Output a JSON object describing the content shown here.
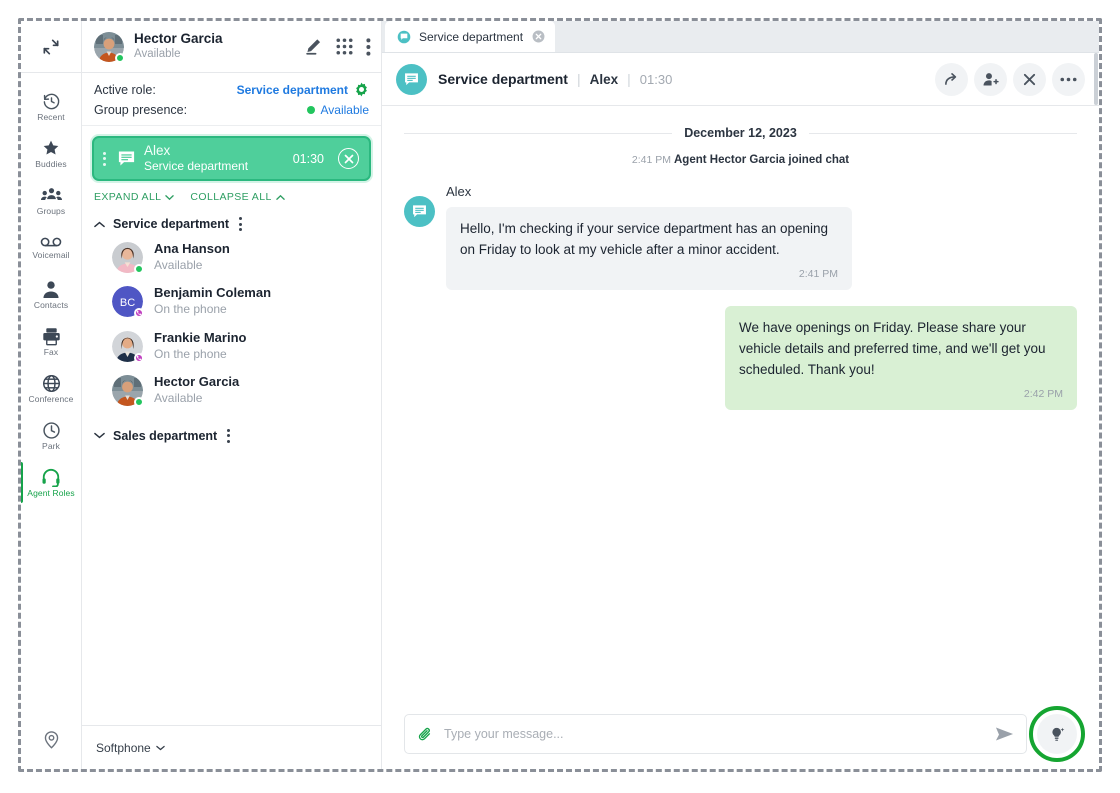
{
  "rail": {
    "collapse_icon": "collapse-arrows-icon",
    "items": [
      {
        "label": "Recent",
        "icon": "history-clock-icon",
        "active": false
      },
      {
        "label": "Buddies",
        "icon": "star-icon",
        "active": false
      },
      {
        "label": "Groups",
        "icon": "people-group-icon",
        "active": false
      },
      {
        "label": "Voicemail",
        "icon": "voicemail-icon",
        "active": false
      },
      {
        "label": "Contacts",
        "icon": "person-icon",
        "active": false
      },
      {
        "label": "Fax",
        "icon": "printer-fax-icon",
        "active": false
      },
      {
        "label": "Conference",
        "icon": "globe-icon",
        "active": false
      },
      {
        "label": "Park",
        "icon": "clock-icon",
        "active": false
      },
      {
        "label": "Agent Roles",
        "icon": "headset-icon",
        "active": true
      }
    ],
    "bottom_icon": "location-pin-icon",
    "active_color": "#16a34a"
  },
  "roster": {
    "user": {
      "name": "Hector Garcia",
      "status": "Available",
      "presence_color": "#22c55e"
    },
    "header_icons": [
      "compose-pencil-icon",
      "dialpad-grid-icon",
      "more-vertical-icon"
    ],
    "active_role_label": "Active role:",
    "active_role_value": "Service department",
    "group_presence_label": "Group presence:",
    "group_presence_value": "Available",
    "settings_icon": "gear-icon",
    "session": {
      "name": "Alex",
      "subtitle": "Service department",
      "timer": "01:30",
      "icon": "chat-bubble-icon",
      "close_icon": "close-circle-icon",
      "bg_color": "#4fcf9b"
    },
    "expand_all": "EXPAND ALL",
    "collapse_all": "COLLAPSE ALL",
    "groups": [
      {
        "title": "Service department",
        "expanded": true,
        "members": [
          {
            "name": "Ana Hanson",
            "status": "Available",
            "avatar_type": "photo",
            "presence": "available"
          },
          {
            "name": "Benjamin Coleman",
            "status": "On the phone",
            "avatar_type": "initials",
            "initials": "BC",
            "avatar_color": "#4f56c4",
            "presence": "phone"
          },
          {
            "name": "Frankie Marino",
            "status": "On the phone",
            "avatar_type": "photo",
            "presence": "phone"
          },
          {
            "name": "Hector Garcia",
            "status": "Available",
            "avatar_type": "photo",
            "presence": "available"
          }
        ]
      },
      {
        "title": "Sales department",
        "expanded": false,
        "members": []
      }
    ],
    "footer": {
      "label": "Softphone",
      "icon": "chevron-down-icon"
    }
  },
  "conversation": {
    "tab": {
      "label": "Service department",
      "icon": "chat-tab-icon",
      "close_icon": "close-icon"
    },
    "header": {
      "avatar_icon": "chat-bubble-icon",
      "title": "Service department",
      "participant": "Alex",
      "timer": "01:30",
      "actions": [
        {
          "name": "transfer-button",
          "icon": "forward-arrow-icon"
        },
        {
          "name": "add-participant-button",
          "icon": "add-person-icon"
        },
        {
          "name": "end-chat-button",
          "icon": "close-x-icon"
        },
        {
          "name": "more-options-button",
          "icon": "more-horizontal-icon"
        }
      ]
    },
    "date_separator": "December 12, 2023",
    "system_message": {
      "time": "2:41 PM",
      "text": "Agent Hector Garcia joined chat"
    },
    "messages": [
      {
        "direction": "incoming",
        "sender": "Alex",
        "text": "Hello, I'm checking if your service department has an opening on Friday to look at my vehicle after a minor accident.",
        "time": "2:41 PM"
      },
      {
        "direction": "outgoing",
        "sender": "",
        "text": "We have openings on Friday. Please share your vehicle details and preferred time, and we'll get you scheduled. Thank you!",
        "time": "2:42 PM"
      }
    ],
    "composer": {
      "attach_icon": "paperclip-icon",
      "placeholder": "Type your message...",
      "value": "",
      "send_icon": "send-arrow-icon",
      "ai_icon": "ai-lightbulb-icon",
      "ai_highlight_color": "#15a531"
    }
  }
}
